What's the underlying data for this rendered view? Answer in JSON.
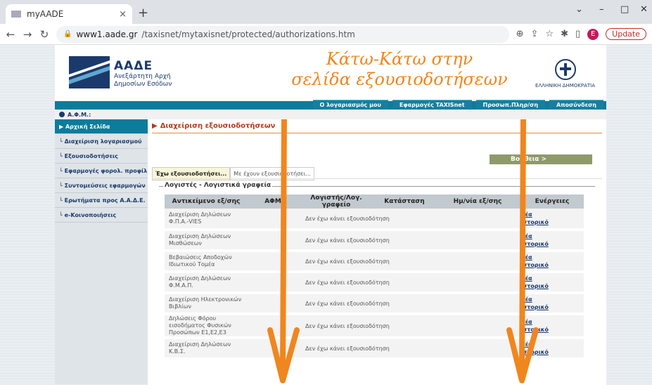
{
  "browser": {
    "tab_title": "myAADE",
    "tab_close": "×",
    "new_tab": "+",
    "url_domain": "www1.aade.gr",
    "url_path": "/taxisnet/mytaxisnet/protected/authorizations.htm",
    "update_label": "Update",
    "avatar_letter": "E",
    "win_min": "–",
    "win_max": "□",
    "win_close": "✕",
    "win_menu": "⌄"
  },
  "header": {
    "brand_name": "ΑΑΔΕ",
    "brand_line1": "Ανεξάρτητη Αρχή",
    "brand_line2": "Δημοσίων Εσόδων",
    "overlay_line1": "Κάτω-Κάτω στην",
    "overlay_line2": "σελίδα εξουσιοδοτήσεων",
    "gov_label": "ΕΛΛΗΝΙΚΗ ΔΗΜΟΚΡΑΤΙΑ"
  },
  "topnav": [
    "Ο λογαριασμός μου",
    "Εφαρμογές TAXISnet",
    "Προσωπ.Πληρ/ση",
    "Αποσύνδεση"
  ],
  "user": {
    "label": "Α.Φ.Μ.:"
  },
  "sidebar": [
    {
      "label": "Αρχική Σελίδα",
      "active": true
    },
    {
      "label": "Διαχείριση λογαριασμού"
    },
    {
      "label": "Εξουσιοδοτήσεις"
    },
    {
      "label": "Εφαρμογές φορολ. προφίλ"
    },
    {
      "label": "Συντομεύσεις εφαρμογών"
    },
    {
      "label": "Ερωτήματα προς Α.Α.Δ.Ε."
    },
    {
      "label": "e-Κοινοποιήσεις"
    }
  ],
  "main": {
    "section_title": "Διαχείριση εξουσιοδοτήσεων",
    "help": "Βοήθεια >",
    "tabs": [
      "Έχω εξουσιοδοτήσει...",
      "Με έχουν εξουσιοδοτήσει..."
    ],
    "fieldset": "Λογιστές - Λογιστικά γραφεία",
    "columns": [
      "Αντικείμενο εξ/σης",
      "ΑΦΜ",
      "Λογιστής/Λογ. γραφείο",
      "Κατάσταση",
      "Ημ/νία εξ/σης",
      "Ενέργειες"
    ],
    "action_new": "Νέα",
    "action_history": "Ιστορικό",
    "status_text": "Δεν έχω κάνει εξουσιοδότηση",
    "rows": [
      "Διαχείριση Δηλώσεων Φ.Π.Α.-VIES",
      "Διαχείριση Δηλώσεων Μισθώσεων",
      "Βεβαιώσεις Αποδοχών Ιδιωτικού Τομέα",
      "Διαχείριση Δηλώσεων Φ.Μ.Α.Π.",
      "Διαχείριση Ηλεκτρονικών Βιβλίων",
      "Δηλώσεις Φόρου εισοδήματος Φυσικών Προσώπων Ε1,Ε2,Ε3",
      "Διαχείριση Δηλώσεων Κ.Β.Σ."
    ]
  }
}
